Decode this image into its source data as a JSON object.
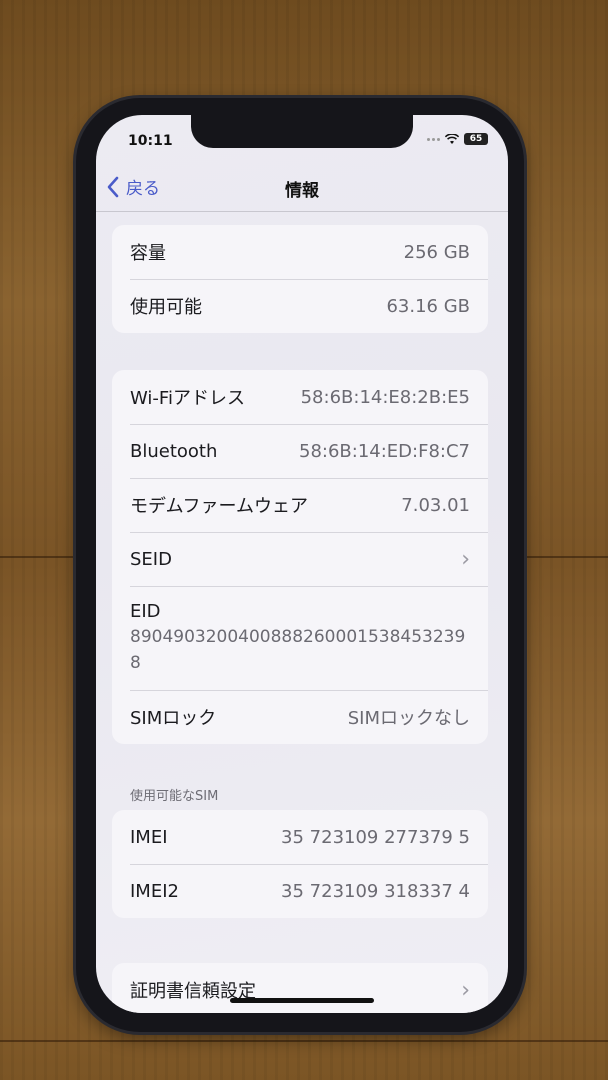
{
  "status_bar": {
    "time": "10:11",
    "battery": "65"
  },
  "nav": {
    "back_label": "戻る",
    "title": "情報"
  },
  "storage": {
    "capacity_label": "容量",
    "capacity_value": "256 GB",
    "available_label": "使用可能",
    "available_value": "63.16 GB"
  },
  "network": {
    "wifi_label": "Wi-Fiアドレス",
    "wifi_value": "58:6B:14:E8:2B:E5",
    "bluetooth_label": "Bluetooth",
    "bluetooth_value": "58:6B:14:ED:F8:C7",
    "modem_label": "モデムファームウェア",
    "modem_value": "7.03.01",
    "seid_label": "SEID",
    "eid_label": "EID",
    "eid_value": "89049032004008882600015384532398",
    "simlock_label": "SIMロック",
    "simlock_value": "SIMロックなし"
  },
  "sim": {
    "header": "使用可能なSIM",
    "imei_label": "IMEI",
    "imei_value": "35 723109 277379 5",
    "imei2_label": "IMEI2",
    "imei2_value": "35 723109 318337 4"
  },
  "certificate": {
    "label": "証明書信頼設定"
  },
  "icons": [
    "chevron-left-icon",
    "wifi-icon",
    "battery-icon",
    "chevron-right-icon"
  ],
  "colors": {
    "accent": "#4a5bc9",
    "background": "#ecebf2",
    "cell": "#f6f5f9"
  }
}
